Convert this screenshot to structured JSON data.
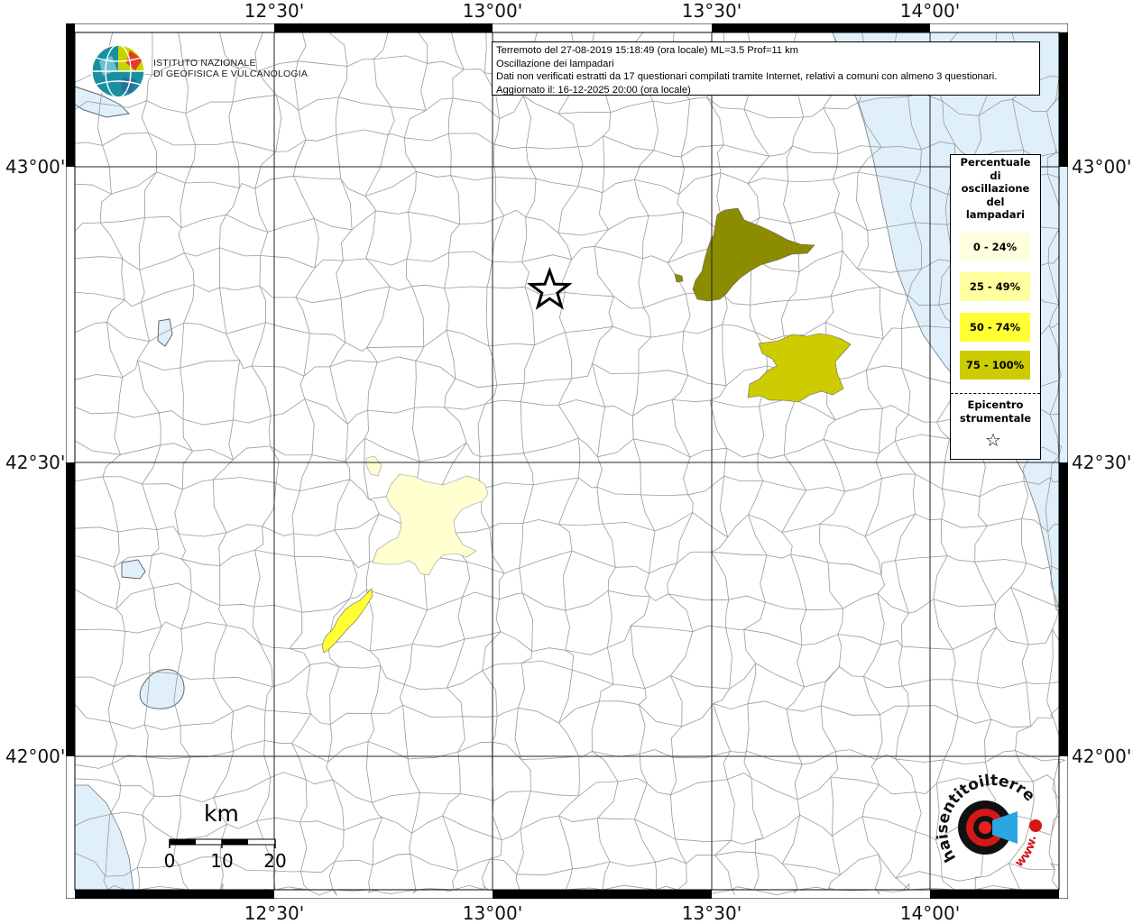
{
  "info": {
    "line1": "Terremoto del 27-08-2019 15:18:49 (ora locale) ML=3.5 Prof=11 km",
    "line2": "Oscillazione dei lampadari",
    "line3": "Dati non verificati estratti da 17 questionari compilati tramite Internet, relativi a comuni con almeno 3 questionari.",
    "line4": "Aggiornato il: 16-12-2025 20:00 (ora locale)"
  },
  "axes": {
    "lon_labels": [
      "12°30'",
      "13°00'",
      "13°30'",
      "14°00'"
    ],
    "lat_labels": [
      "43°00'",
      "42°30'",
      "42°00'"
    ]
  },
  "legend": {
    "title_lines": [
      "Percentuale",
      "di",
      "oscillazione",
      "del",
      "lampadari"
    ],
    "classes": [
      {
        "label": "0 - 24%",
        "color": "#ffffdf"
      },
      {
        "label": "25 - 49%",
        "color": "#ffff9e"
      },
      {
        "label": "50 - 74%",
        "color": "#ffff33"
      },
      {
        "label": "75 - 100%",
        "color": "#cccc00"
      }
    ],
    "epicenter_lines": [
      "Epicentro",
      "strumentale"
    ],
    "epicenter_symbol": "☆"
  },
  "map": {
    "epicenter": {
      "lon": 13.13,
      "lat": 42.79
    },
    "sea_color": "#dff0fb",
    "areas": [
      {
        "class": "75 - 100%",
        "color": "#8c8c00"
      },
      {
        "class": "75 - 100%",
        "color": "#cccc00"
      },
      {
        "class": "0 - 24%",
        "color": "#ffffcf"
      },
      {
        "class": "50 - 74%",
        "color": "#ffff33"
      }
    ]
  },
  "scale": {
    "unit": "km",
    "ticks": [
      "0",
      "10",
      "20"
    ]
  },
  "logos": {
    "ingv_line1": "ISTITUTO NAZIONALE",
    "ingv_line2": "DI GEOFISICA E VULCANOLOGIA",
    "hst_text": "haisentitoilterremoto.it",
    "hst_www": "www."
  }
}
